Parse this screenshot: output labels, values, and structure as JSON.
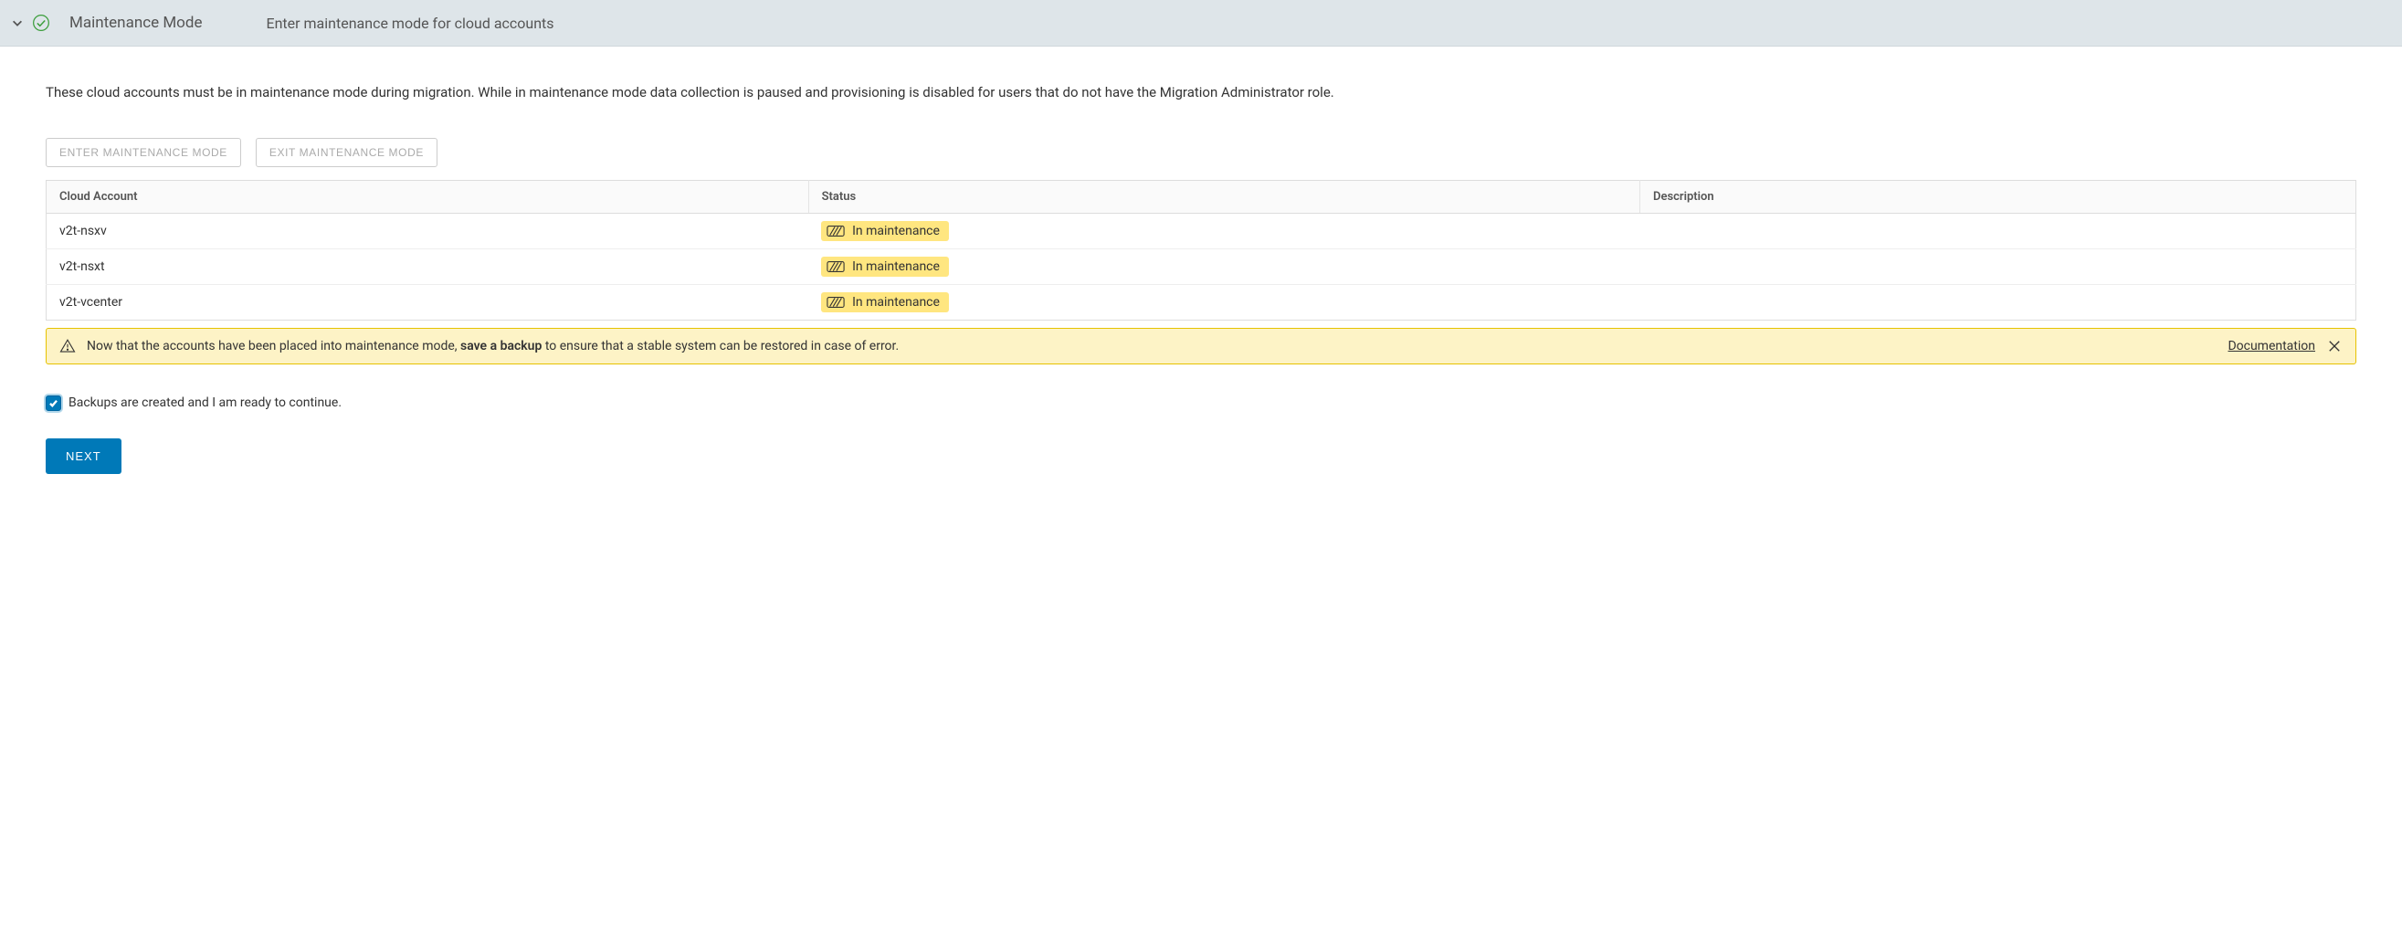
{
  "header": {
    "title": "Maintenance Mode",
    "subtitle": "Enter maintenance mode for cloud accounts"
  },
  "description": "These cloud accounts must be in maintenance mode during migration. While in maintenance mode data collection is paused and provisioning is disabled for users that do not have the Migration Administrator role.",
  "buttons": {
    "enter": "ENTER MAINTENANCE MODE",
    "exit": "EXIT MAINTENANCE MODE",
    "next": "NEXT"
  },
  "table": {
    "headers": {
      "account": "Cloud Account",
      "status": "Status",
      "description": "Description"
    },
    "rows": [
      {
        "account": "v2t-nsxv",
        "status": "In maintenance",
        "description": ""
      },
      {
        "account": "v2t-nsxt",
        "status": "In maintenance",
        "description": ""
      },
      {
        "account": "v2t-vcenter",
        "status": "In maintenance",
        "description": ""
      }
    ]
  },
  "alert": {
    "prefix": "Now that the accounts have been placed into maintenance mode, ",
    "bold": "save a backup",
    "suffix": " to ensure that a stable system can be restored in case of error.",
    "doc_link": "Documentation"
  },
  "checkbox": {
    "label": "Backups are created and I am ready to continue.",
    "checked": true
  }
}
